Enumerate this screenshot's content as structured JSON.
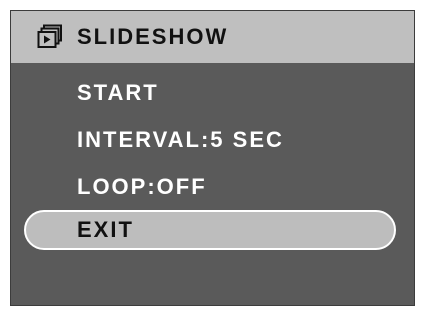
{
  "header": {
    "icon": "slideshow-icon",
    "title": "SLIDESHOW"
  },
  "menu": {
    "items": [
      {
        "label": "START"
      },
      {
        "label": "INTERVAL:5 SEC"
      },
      {
        "label": "LOOP:OFF"
      },
      {
        "label": "EXIT",
        "selected": true
      }
    ]
  },
  "colors": {
    "background": "#5a5a5a",
    "header": "#bfbfbf",
    "selected": "#bdbdbd",
    "text_light": "#ffffff",
    "text_dark": "#111111"
  }
}
